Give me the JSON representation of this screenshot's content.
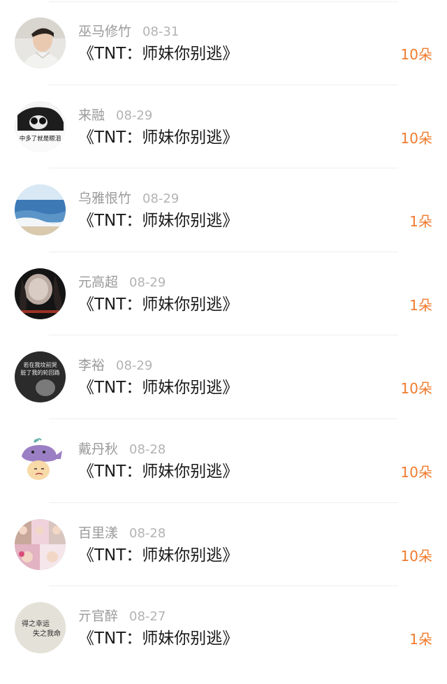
{
  "gift_list": [
    {
      "name": "巫马修竹",
      "date": "08-31",
      "book": "《TNT：师妹你别逃》",
      "amount": "10朵",
      "avatar": "avatar-young-man-photo"
    },
    {
      "name": "来融",
      "date": "08-29",
      "book": "《TNT：师妹你别逃》",
      "amount": "10朵",
      "avatar": "avatar-bw-photo-with-caption",
      "avatar_caption": "中多了就是眼泪"
    },
    {
      "name": "乌雅恨竹",
      "date": "08-29",
      "book": "《TNT：师妹你别逃》",
      "amount": "1朵",
      "avatar": "avatar-sea-waves"
    },
    {
      "name": "元高超",
      "date": "08-29",
      "book": "《TNT：师妹你别逃》",
      "amount": "1朵",
      "avatar": "avatar-dark-face-photo"
    },
    {
      "name": "李裕",
      "date": "08-29",
      "book": "《TNT：师妹你别逃》",
      "amount": "10朵",
      "avatar": "avatar-dark-text-photo",
      "avatar_caption_lines": [
        "若在我坟前哭",
        "脏了我的轮回路"
      ]
    },
    {
      "name": "戴丹秋",
      "date": "08-28",
      "book": "《TNT：师妹你别逃》",
      "amount": "10朵",
      "avatar": "avatar-cartoon-whale"
    },
    {
      "name": "百里漾",
      "date": "08-28",
      "book": "《TNT：师妹你别逃》",
      "amount": "10朵",
      "avatar": "avatar-collage-photo"
    },
    {
      "name": "亓官醉",
      "date": "08-27",
      "book": "《TNT：师妹你别逃》",
      "amount": "1朵",
      "avatar": "avatar-calligraphy",
      "avatar_caption_lines": [
        "得之幸运",
        "失之我命"
      ]
    }
  ],
  "colors": {
    "amount_orange": "#f07b2e",
    "name_gray": "#9a9a9a",
    "date_gray": "#b3b3b3",
    "title_black": "#1a1a1a",
    "divider": "#eeeeee"
  }
}
